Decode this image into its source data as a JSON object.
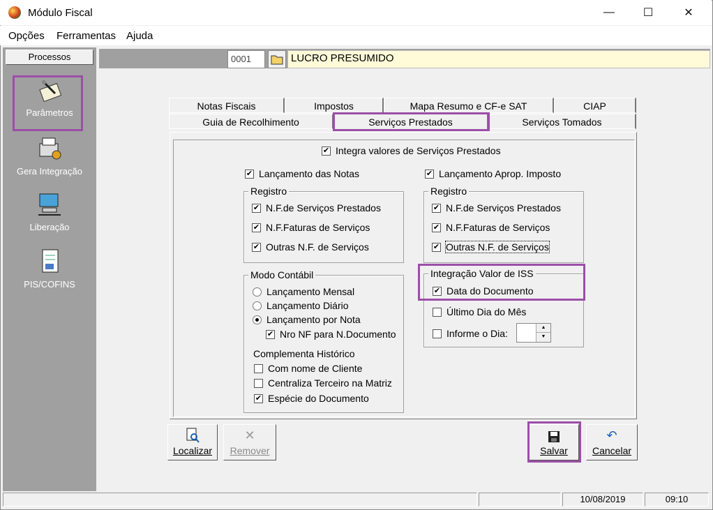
{
  "window": {
    "title": "Módulo Fiscal",
    "minimize": "—",
    "maximize": "☐",
    "close": "✕"
  },
  "menu": {
    "opcoes": "Opções",
    "ferramentas": "Ferramentas",
    "ajuda": "Ajuda"
  },
  "sidebar": {
    "header": "Processos",
    "items": [
      {
        "label": "Parâmetros",
        "icon": "notepad-pencil-icon"
      },
      {
        "label": "Gera Integração",
        "icon": "printer-gear-icon"
      },
      {
        "label": "Liberação",
        "icon": "computer-network-icon"
      },
      {
        "label": "PIS/COFINS",
        "icon": "document-tools-icon"
      }
    ]
  },
  "company": {
    "code": "0001",
    "name": "LUCRO PRESUMIDO"
  },
  "tabs": {
    "row1": [
      "Notas Fiscais",
      "Impostos",
      "Mapa Resumo e CF-e SAT",
      "CIAP"
    ],
    "row2": [
      "Guia de Recolhimento",
      "Serviços Prestados",
      "Serviços Tomados"
    ],
    "active": "Serviços Prestados"
  },
  "form": {
    "integra": {
      "label": "Integra valores de Serviços Prestados",
      "checked": true
    },
    "lancamento_notas": {
      "label": "Lançamento das Notas",
      "checked": true
    },
    "lancamento_aprop": {
      "label": "Lançamento Aprop. Imposto",
      "checked": true
    },
    "registro_left": {
      "title": "Registro",
      "items": [
        {
          "label": "N.F.de Serviços Prestados",
          "checked": true
        },
        {
          "label": "N.F.Faturas de Serviços",
          "checked": true
        },
        {
          "label": "Outras N.F. de Serviços",
          "checked": true
        }
      ]
    },
    "registro_right": {
      "title": "Registro",
      "items": [
        {
          "label": "N.F.de Serviços Prestados",
          "checked": true
        },
        {
          "label": "N.F.Faturas de Serviços",
          "checked": true
        },
        {
          "label": "Outras N.F. de Serviços",
          "checked": true
        }
      ]
    },
    "modo_contabil": {
      "title": "Modo Contábil",
      "radios": [
        {
          "label": "Lançamento Mensal",
          "selected": false
        },
        {
          "label": "Lançamento Diário",
          "selected": false
        },
        {
          "label": "Lançamento por Nota",
          "selected": true
        }
      ],
      "nro_nf": {
        "label": "Nro NF para N.Documento",
        "checked": true
      },
      "complementa_title": "Complementa Histórico",
      "complementa": [
        {
          "label": "Com nome de Cliente",
          "checked": false
        },
        {
          "label": "Centraliza Terceiro na Matriz",
          "checked": false
        },
        {
          "label": "Espécie do Documento",
          "checked": true
        }
      ]
    },
    "integracao_iss": {
      "title": "Integração Valor de ISS",
      "data_documento": {
        "label": "Data do Documento",
        "checked": true
      },
      "ultimo_dia": {
        "label": "Último Dia do Mês",
        "checked": false
      },
      "informe_dia": {
        "label": "Informe o Dia:",
        "checked": false
      }
    }
  },
  "buttons": {
    "localizar": "Localizar",
    "remover": "Remover",
    "salvar": "Salvar",
    "cancelar": "Cancelar"
  },
  "status": {
    "date": "10/08/2019",
    "time": "09:10"
  },
  "colors": {
    "highlight": "#9b4fa8",
    "sidebar": "#a0a0a0",
    "company_bg": "#fffbd9"
  }
}
